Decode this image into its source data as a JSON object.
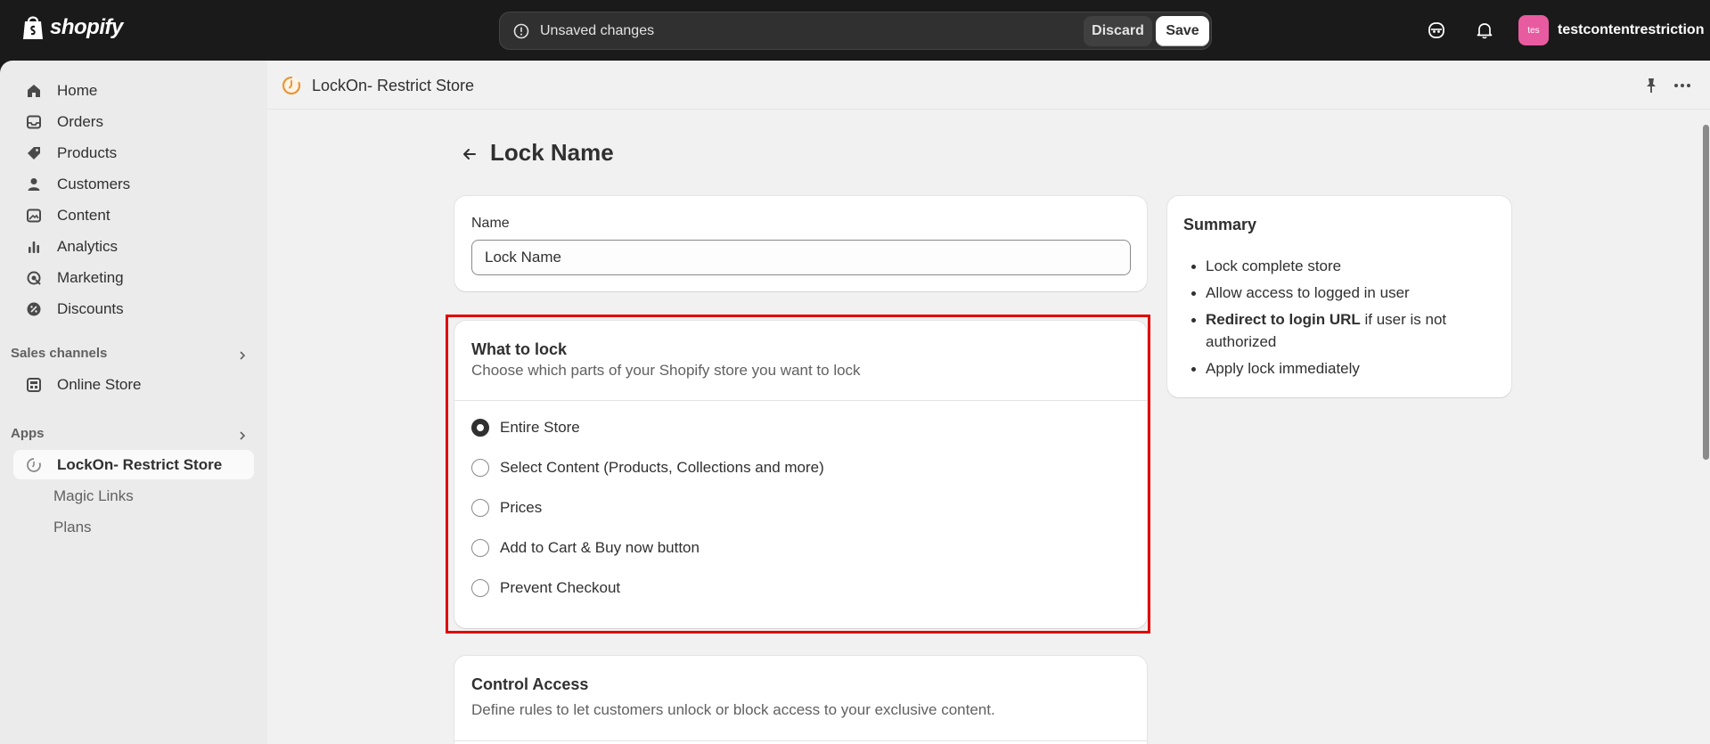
{
  "topbar": {
    "brand": "shopify",
    "unsaved_text": "Unsaved changes",
    "discard_label": "Discard",
    "save_label": "Save",
    "avatar_initials": "tes",
    "account_name": "testcontentrestriction"
  },
  "sidebar": {
    "items": [
      {
        "label": "Home",
        "icon": "home-icon"
      },
      {
        "label": "Orders",
        "icon": "inbox-icon"
      },
      {
        "label": "Products",
        "icon": "tag-icon"
      },
      {
        "label": "Customers",
        "icon": "person-icon"
      },
      {
        "label": "Content",
        "icon": "image-icon"
      },
      {
        "label": "Analytics",
        "icon": "bar-chart-icon"
      },
      {
        "label": "Marketing",
        "icon": "target-icon"
      },
      {
        "label": "Discounts",
        "icon": "discount-icon"
      }
    ],
    "sales_channels_label": "Sales channels",
    "online_store_label": "Online Store",
    "apps_label": "Apps",
    "app_item_label": "LockOn- Restrict Store",
    "app_sub_items": [
      "Magic Links",
      "Plans"
    ]
  },
  "app_header": {
    "title": "LockOn- Restrict Store"
  },
  "page": {
    "title": "Lock Name",
    "name_field": {
      "label": "Name",
      "value": "Lock Name"
    },
    "what_to_lock": {
      "heading": "What to lock",
      "subheading": "Choose which parts of your Shopify store you want to lock",
      "options": [
        {
          "label": "Entire Store",
          "checked": true
        },
        {
          "label": "Select Content (Products, Collections and more)",
          "checked": false
        },
        {
          "label": "Prices",
          "checked": false
        },
        {
          "label": "Add to Cart & Buy now button",
          "checked": false
        },
        {
          "label": "Prevent Checkout",
          "checked": false
        }
      ]
    },
    "control_access": {
      "heading": "Control Access",
      "subheading": "Define rules to let customers unlock or block access to your exclusive content."
    },
    "summary": {
      "title": "Summary",
      "item1": "Lock complete store",
      "item2": "Allow access to logged in user",
      "item3_bold": "Redirect to login URL",
      "item3_rest": " if user is not authorized",
      "item4": "Apply lock immediately"
    }
  },
  "colors": {
    "highlight": "#e00000",
    "avatar": "#e95ba0",
    "app_icon": "#e8973a"
  }
}
